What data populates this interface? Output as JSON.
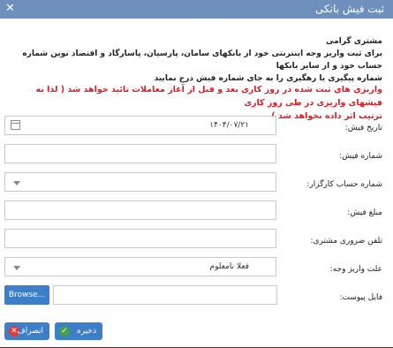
{
  "window": {
    "title": "ثبت فیش بانکی",
    "close_icon": "close-icon"
  },
  "intro": {
    "greeting": "مشتری گرامی",
    "line1": "برای ثبت واریز وجه اینترنتی خود از بانکهای سامان، پارسیان، پاسارگاد و اقتصاد نوین شماره حساب خود و از سایر بانکها",
    "line2": "شماره پیگیری یا رهگیری را به جای شماره فیش درج نمایید"
  },
  "warning": {
    "line1": "واریزی های ثبت شده در روز کاری بعد و قبل از آغاز معاملات تائید خواهد شد ( لذا به فیشهای واریزی در طی روز کاری",
    "line2": "ترتیب اثر داده نخواهد شد )"
  },
  "form": {
    "receipt_date": {
      "label": "تاریخ فیش:",
      "value": "۱۴۰۴/۰۷/۲۱"
    },
    "receipt_number": {
      "label": "شماره فیش:",
      "value": ""
    },
    "broker_account": {
      "label": "شماره حساب کارگزار:",
      "value": ""
    },
    "amount": {
      "label": "مبلغ فیش:",
      "value": ""
    },
    "phone": {
      "label": "تلفن ضروری مشتری:",
      "value": ""
    },
    "deposit_reason": {
      "label": "علت واریز وجه:",
      "value": "فعلا نامعلوم"
    },
    "attachment": {
      "label": "فایل پیوست:",
      "browse_label": "Browse..."
    }
  },
  "buttons": {
    "save_label": "ذخیره",
    "cancel_label": "انصراف"
  },
  "colors": {
    "titlebar": "#6f8fbd",
    "button": "#3d7ec8",
    "warning": "#e0191f"
  }
}
